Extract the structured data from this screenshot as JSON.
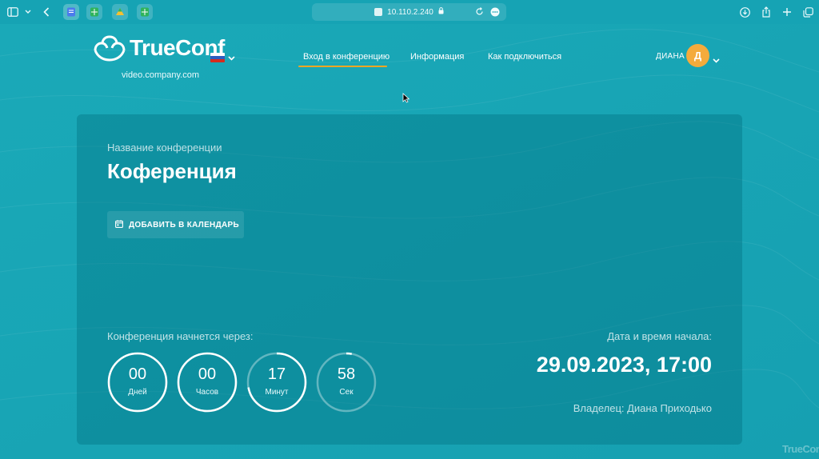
{
  "browser": {
    "address": "10.110.2.240"
  },
  "header": {
    "logo_text": "TrueConf",
    "domain": "video.company.com",
    "nav": [
      {
        "label": "Вход в конференцию"
      },
      {
        "label": "Информация"
      },
      {
        "label": "Как подключиться"
      }
    ],
    "user_name": "ДИАНА",
    "avatar_initial": "Д"
  },
  "conference": {
    "name_label": "Название конференции",
    "name": "Коференция",
    "add_calendar": "ДОБАВИТЬ В КАЛЕНДАРЬ",
    "starts_in_label": "Конференция начнется через:",
    "countdown": [
      {
        "value": "00",
        "unit": "Дней",
        "fill": 1.0
      },
      {
        "value": "00",
        "unit": "Часов",
        "fill": 1.0
      },
      {
        "value": "17",
        "unit": "Минут",
        "fill": 0.72
      },
      {
        "value": "58",
        "unit": "Сек",
        "fill": 0.03
      }
    ],
    "start_label": "Дата и время начала:",
    "start_value": "29.09.2023, 17:00",
    "owner": "Владелец: Диана Приходько"
  },
  "watermark": "TrueConf",
  "colors": {
    "accent": "#f5a623",
    "avatar": "#f4ab3c",
    "background": "#1aa6b6"
  }
}
